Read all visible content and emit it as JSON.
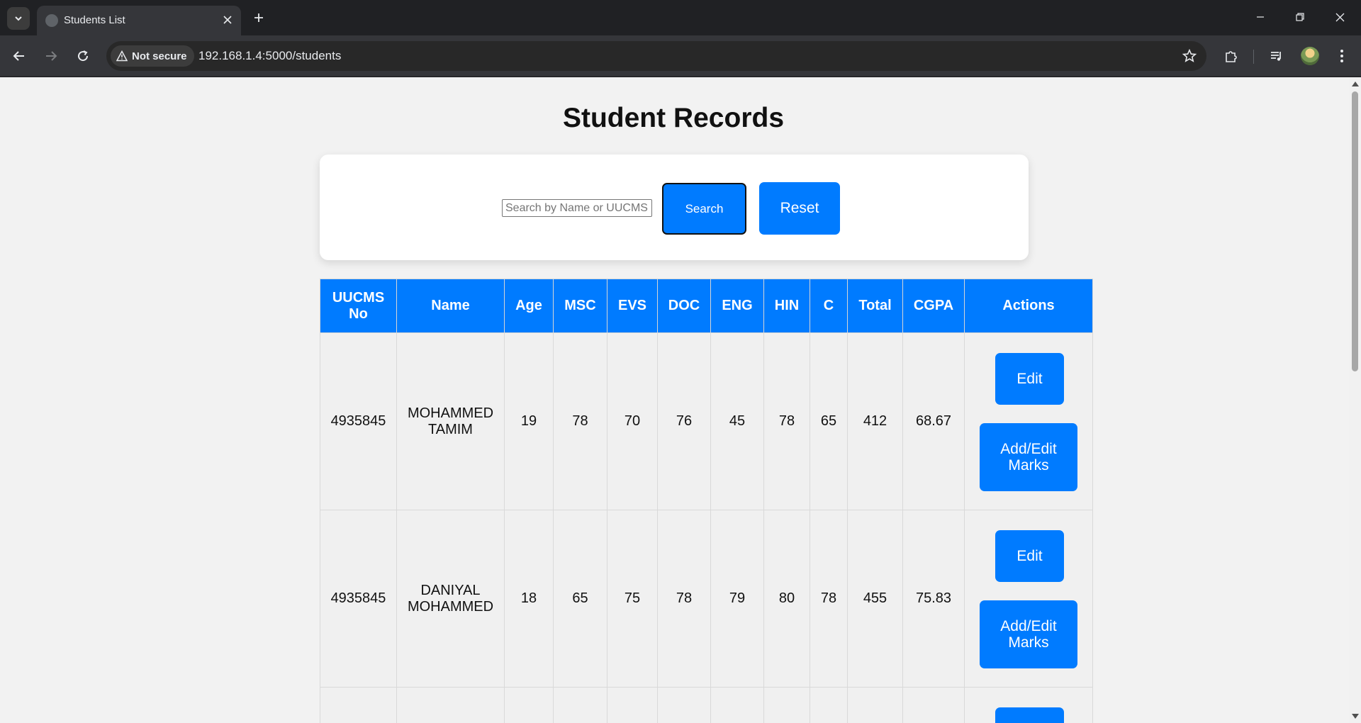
{
  "browser": {
    "tab_title": "Students List",
    "security_label": "Not secure",
    "url": "192.168.1.4:5000/students"
  },
  "page": {
    "title": "Student Records",
    "search": {
      "placeholder": "Search by Name or UUCMS No",
      "value": "",
      "search_label": "Search",
      "reset_label": "Reset"
    },
    "table": {
      "headers": [
        "UUCMS No",
        "Name",
        "Age",
        "MSC",
        "EVS",
        "DOC",
        "ENG",
        "HIN",
        "C",
        "Total",
        "CGPA",
        "Actions"
      ],
      "rows": [
        {
          "uucms": "4935845",
          "name": "MOHAMMED TAMIM",
          "age": "19",
          "msc": "78",
          "evs": "70",
          "doc": "76",
          "eng": "45",
          "hin": "78",
          "c": "65",
          "total": "412",
          "cgpa": "68.67"
        },
        {
          "uucms": "4935845",
          "name": "DANIYAL MOHAMMED",
          "age": "18",
          "msc": "65",
          "evs": "75",
          "doc": "78",
          "eng": "79",
          "hin": "80",
          "c": "78",
          "total": "455",
          "cgpa": "75.83"
        }
      ],
      "edit_label": "Edit",
      "marks_label": "Add/Edit Marks"
    }
  },
  "colors": {
    "accent": "#007bff",
    "page_bg": "#f2f2f2",
    "chrome_bg": "#202124"
  }
}
